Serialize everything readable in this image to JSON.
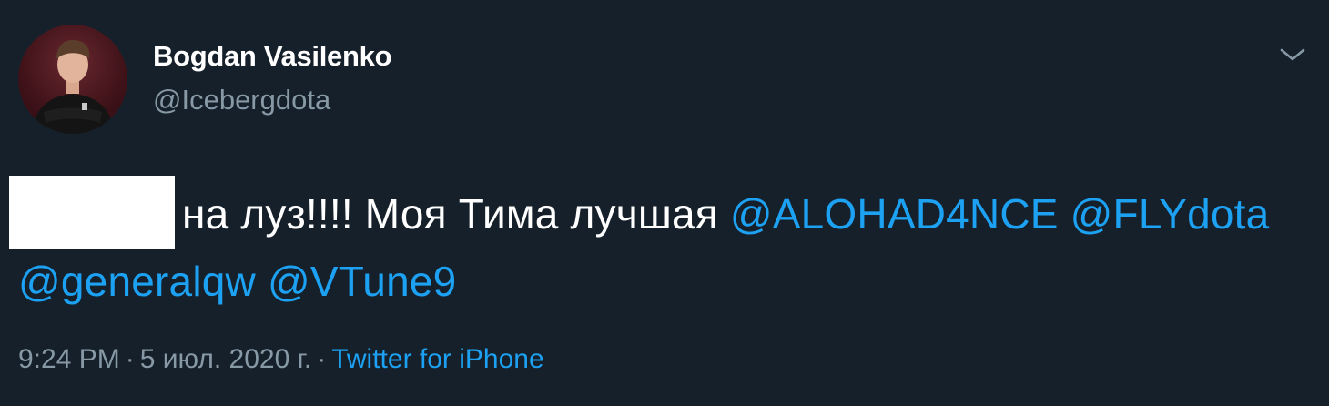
{
  "user": {
    "display_name": "Bogdan Vasilenko",
    "handle": "@Icebergdota"
  },
  "tweet": {
    "text": "на луз!!!! Моя Тима лучшая",
    "mentions": [
      "@ALOHAD4NCE",
      "@FLYdota",
      "@generalqw",
      "@VTune9"
    ]
  },
  "meta": {
    "time": "9:24 PM",
    "separator": "·",
    "date": "5 июл. 2020 г.",
    "source": "Twitter for iPhone"
  },
  "icons": {
    "menu": "chevron-down-icon"
  },
  "colors": {
    "background": "#15202b",
    "text": "#ffffff",
    "secondary_text": "#8899a6",
    "link": "#1da1f2",
    "redaction": "#ffffff"
  }
}
